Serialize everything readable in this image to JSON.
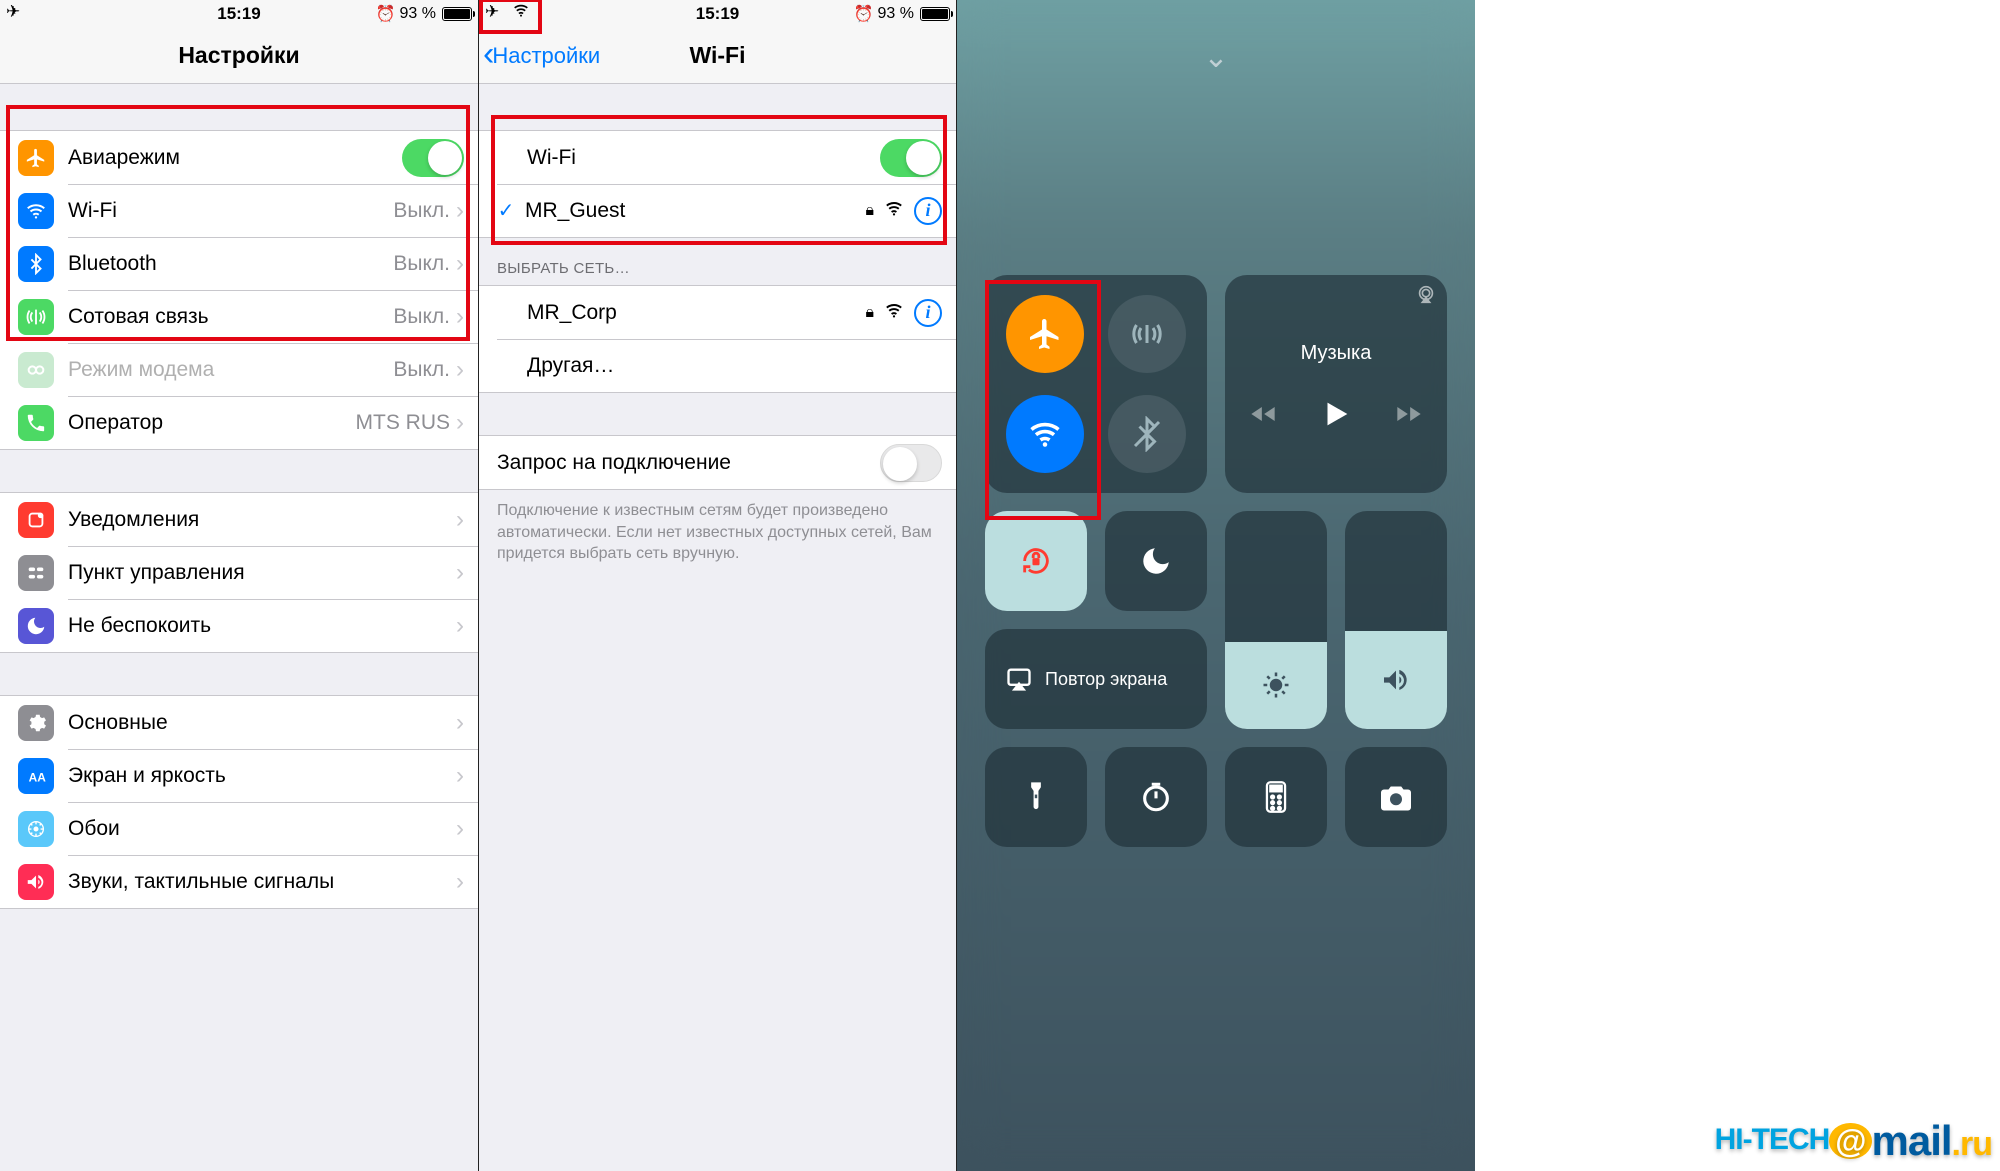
{
  "status": {
    "time": "15:19",
    "battery_pct": "93 %"
  },
  "p1": {
    "title": "Настройки",
    "rows": {
      "airplane": "Авиарежим",
      "wifi": "Wi-Fi",
      "wifi_val": "Выкл.",
      "bt": "Bluetooth",
      "bt_val": "Выкл.",
      "cell": "Сотовая связь",
      "cell_val": "Выкл.",
      "hotspot": "Режим модема",
      "hotspot_val": "Выкл.",
      "carrier": "Оператор",
      "carrier_val": "MTS RUS",
      "notif": "Уведомления",
      "cc": "Пункт управления",
      "dnd": "Не беспокоить",
      "general": "Основные",
      "display": "Экран и яркость",
      "wallpaper": "Обои",
      "sounds": "Звуки, тактильные сигналы"
    }
  },
  "p2": {
    "back": "Настройки",
    "title": "Wi-Fi",
    "wifi_label": "Wi-Fi",
    "connected": "MR_Guest",
    "choose_header": "ВЫБРАТЬ СЕТЬ…",
    "net1": "MR_Corp",
    "other": "Другая…",
    "ask_label": "Запрос на подключение",
    "ask_note": "Подключение к известным сетям будет произведено автоматически. Если нет известных доступных сетей, Вам придется выбрать сеть вручную."
  },
  "p3": {
    "music": "Музыка",
    "mirror": "Повтор экрана"
  },
  "watermark": {
    "hi": "HI-TECH",
    "mail": "mail",
    "ru": ".ru"
  }
}
